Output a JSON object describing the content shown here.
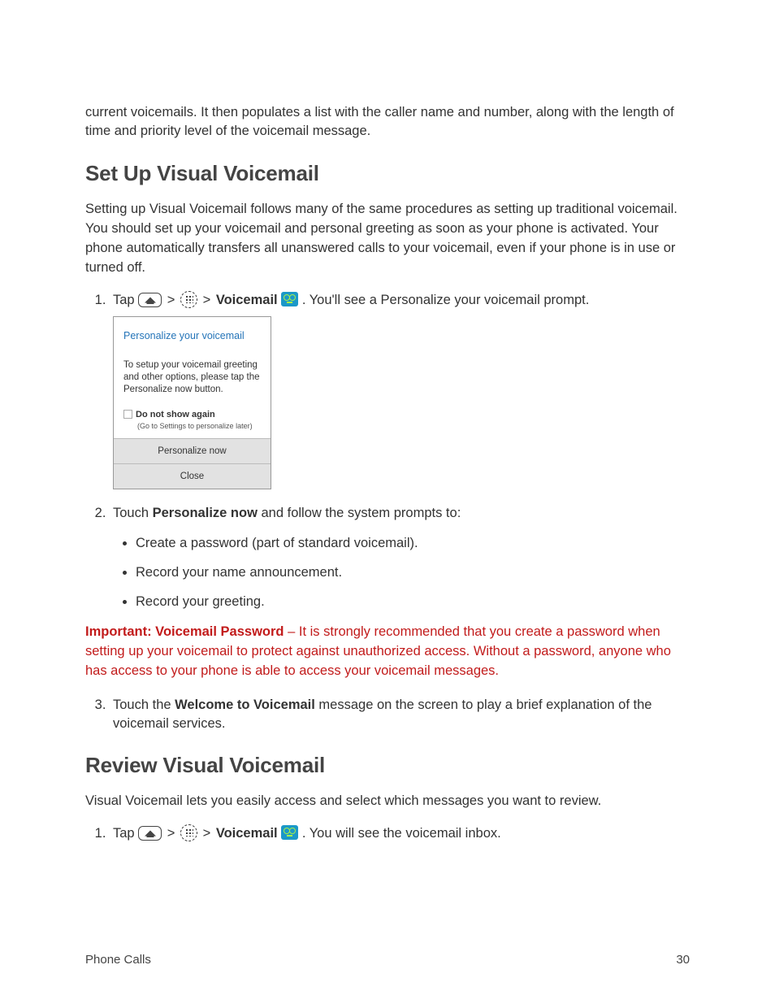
{
  "intro_paragraph": "current voicemails. It then populates a list with the caller name and number, along with the length of time and priority level of the voicemail message.",
  "section1": {
    "heading": "Set Up Visual Voicemail",
    "intro": "Setting up Visual Voicemail follows many of the same procedures as setting up traditional voicemail. You should set up your voicemail and personal greeting as soon as your phone is activated. Your phone automatically transfers all unanswered calls to your voicemail, even if your phone is in use or turned off.",
    "step1": {
      "prefix": "Tap ",
      "sep": " > ",
      "vm_label": "Voicemail",
      "suffix": " . You'll see a Personalize your voicemail prompt."
    },
    "dialog": {
      "title": "Personalize your voicemail",
      "msg": "To setup your voicemail greeting and other options, please tap the Personalize now button.",
      "chk_label": "Do not show again",
      "chk_sub": "(Go to Settings to personalize later)",
      "btn1": "Personalize now",
      "btn2": "Close"
    },
    "step2": {
      "prefix": "Touch ",
      "bold": "Personalize now",
      "suffix": " and follow the system prompts to:",
      "bullets": [
        "Create a password (part of standard voicemail).",
        "Record your name announcement.",
        "Record your greeting."
      ]
    },
    "warning": {
      "bold": "Important: Voicemail Password",
      "rest": " – It is strongly recommended that you create a password when setting up your voicemail to protect against unauthorized access. Without a password, anyone who has access to your phone is able to access your voicemail messages."
    },
    "step3": {
      "prefix": "Touch the ",
      "bold": "Welcome to Voicemail",
      "suffix": " message on the screen to play a brief explanation of the voicemail services."
    }
  },
  "section2": {
    "heading": "Review Visual Voicemail",
    "intro": "Visual Voicemail lets you easily access and select which messages you want to review.",
    "step1": {
      "prefix": "Tap ",
      "sep": " > ",
      "vm_label": "Voicemail",
      "suffix": " . You will see the voicemail inbox."
    }
  },
  "footer": {
    "left": "Phone Calls",
    "right": "30"
  }
}
